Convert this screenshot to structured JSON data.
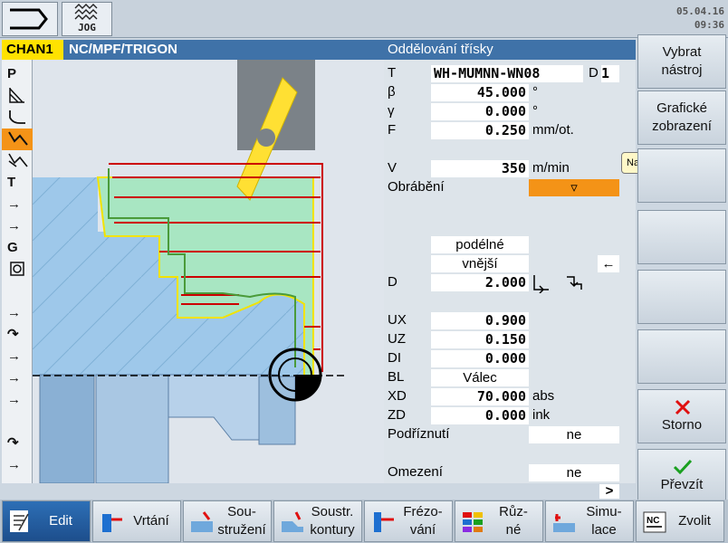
{
  "topbar": {
    "mode": "JOG",
    "date": "05.04.16",
    "time": "09:36"
  },
  "header": {
    "channel": "CHAN1",
    "path": "NC/MPF/TRIGON",
    "form_title": "Oddělování třísky"
  },
  "left_toolbar": [
    "P",
    "",
    "",
    "",
    "",
    "T",
    "→",
    "→",
    "G",
    "",
    "",
    "→",
    "↷",
    "→",
    "→",
    "→",
    "↷",
    "→"
  ],
  "form": {
    "T_label": "T",
    "T_value": "WH-MUMNN-WN08",
    "D_label": "D",
    "D_value": "1",
    "beta_label": "β",
    "beta_value": "45.000",
    "beta_unit": "°",
    "gamma_label": "γ",
    "gamma_value": "0.000",
    "gamma_unit": "°",
    "F_label": "F",
    "F_value": "0.250",
    "F_unit": "mm/ot.",
    "V_label": "V",
    "V_value": "350",
    "V_unit": "m/min",
    "obrabeni_label": "Obrábění",
    "obrabeni_value": "▿",
    "direction1": "podélné",
    "direction2": "vnější",
    "arrow_left": "←",
    "Dd_label": "D",
    "Dd_value": "2.000",
    "UX_label": "UX",
    "UX_value": "0.900",
    "UZ_label": "UZ",
    "UZ_value": "0.150",
    "DI_label": "DI",
    "DI_value": "0.000",
    "BL_label": "BL",
    "BL_value": "Válec",
    "XD_label": "XD",
    "XD_value": "70.000",
    "XD_unit": "abs",
    "ZD_label": "ZD",
    "ZD_value": "0.000",
    "ZD_unit": "ink",
    "podriznuti_label": "Podříznutí",
    "podriznuti_value": "ne",
    "omezeni_label": "Omezení",
    "omezeni_value": "ne",
    "more": ">"
  },
  "right_softkeys": {
    "vybrat": [
      "Vybrat",
      "nástroj"
    ],
    "graficke": [
      "Grafické",
      "zobrazení"
    ],
    "nahrubo": "Nahrubo",
    "storno": "Storno",
    "prevzit": "Převzít"
  },
  "bottom_softkeys": [
    {
      "label": "Edit"
    },
    {
      "label": "Vrtání"
    },
    {
      "label": "Sou-\nstružení"
    },
    {
      "label": "Soustr.\nkontury"
    },
    {
      "label": "Frézo-\nvání"
    },
    {
      "label": "Růz-\nné"
    },
    {
      "label": "Simu-\nlace"
    },
    {
      "label": "Zvolit"
    }
  ],
  "colors": {
    "channel_bg": "#ffe200",
    "title_bg": "#3f72a8",
    "selected": "#f49317",
    "path_red": "#cc0000"
  }
}
